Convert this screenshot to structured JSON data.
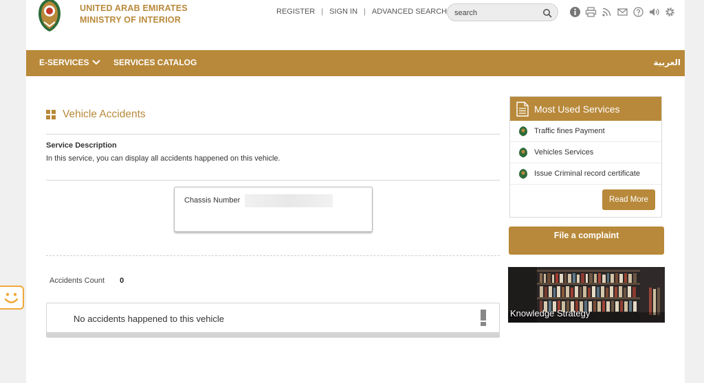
{
  "header": {
    "org_line1": "UNITED ARAB EMIRATES",
    "org_line2": "MINISTRY OF INTERIOR",
    "links": [
      "REGISTER",
      "SIGN IN",
      "ADVANCED SEARCH"
    ],
    "search_placeholder": "search",
    "tool_icons": [
      "info-icon",
      "print-icon",
      "rss-icon",
      "mail-icon",
      "help-icon",
      "volume-icon",
      "settings-icon"
    ]
  },
  "nav": {
    "items": [
      "E-SERVICES",
      "SERVICES CATALOG"
    ],
    "language": "العربية"
  },
  "main": {
    "title": "Vehicle Accidents",
    "service_description_heading": "Service Description",
    "service_description": "In this service, you can display all accidents happened on this vehicle.",
    "chassis_label": "Chassis Number",
    "accidents_count_label": "Accidents Count",
    "accidents_count": "0",
    "alert_message": "No accidents happened to this vehicle"
  },
  "sidebar": {
    "most_used_title": "Most Used Services",
    "most_used_items": [
      "Traffic fines Payment",
      "Vehicles Services",
      "Issue Criminal record certificate"
    ],
    "read_more_label": "Read More",
    "complaint_label": "File a complaint",
    "knowledge_label": "Knowledge Strategy"
  },
  "colors": {
    "accent": "#b8893a"
  }
}
